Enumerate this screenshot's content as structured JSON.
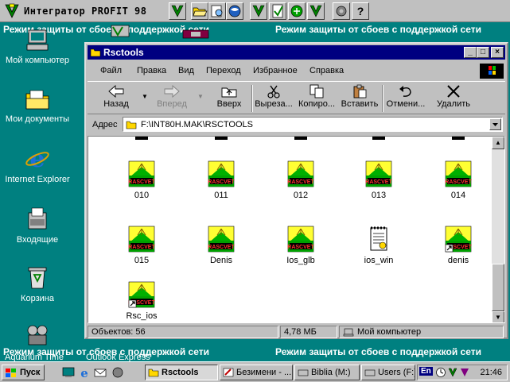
{
  "top_bar": {
    "title": "Интегратор PROFIT 98"
  },
  "banner": {
    "left": "Режим защиты от сбоев с поддержкой сети",
    "right": "Режим защиты от сбоев с поддержкой сети"
  },
  "desktop_icons": [
    {
      "label": "Мой компьютер",
      "icon": "my-computer-icon"
    },
    {
      "label": "Мои документы",
      "icon": "my-documents-icon"
    },
    {
      "label": "Internet Explorer",
      "icon": "internet-explorer-icon"
    },
    {
      "label": "Входящие",
      "icon": "inbox-icon"
    },
    {
      "label": "Корзина",
      "icon": "recycle-bin-icon"
    }
  ],
  "desktop_bottom_labels": {
    "aquarium": "Aquarium Time",
    "outlook": "Outlook Express"
  },
  "window": {
    "title": "Rsctools",
    "menu": [
      "Файл",
      "Правка",
      "Вид",
      "Переход",
      "Избранное",
      "Справка"
    ],
    "toolbar": {
      "back": "Назад",
      "forward": "Вперед",
      "up": "Вверх",
      "cut": "Выреза...",
      "copy": "Копиро...",
      "paste": "Вставить",
      "undo": "Отмени...",
      "delete": "Удалить"
    },
    "address": {
      "label": "Адрес",
      "value": "F:\\INT80H.MAK\\RSCTOOLS"
    },
    "files": [
      {
        "name": "010",
        "type": "rscvet"
      },
      {
        "name": "011",
        "type": "rscvet"
      },
      {
        "name": "012",
        "type": "rscvet"
      },
      {
        "name": "013",
        "type": "rscvet"
      },
      {
        "name": "014",
        "type": "rscvet"
      },
      {
        "name": "015",
        "type": "rscvet"
      },
      {
        "name": "Denis",
        "type": "rscvet"
      },
      {
        "name": "Ios_glb",
        "type": "rscvet"
      },
      {
        "name": "ios_win",
        "type": "notepad"
      },
      {
        "name": "denis",
        "type": "rscvet-shortcut"
      },
      {
        "name": "Rsc_ios",
        "type": "rscvet-shortcut"
      }
    ],
    "icon_caption": "RASCVET",
    "status": {
      "objects": "Объектов: 56",
      "size": "4,78 МБ",
      "location": "Мой компьютер"
    }
  },
  "taskbar": {
    "start": "Пуск",
    "tasks": [
      "Rsctools",
      "Безимени - ...",
      "Biblia (M:)",
      "Users (F:)"
    ],
    "tray_lang": "En",
    "clock": "21:46"
  },
  "colors": {
    "desktop": "#008080",
    "titlebar": "#000080",
    "face": "#c0c0c0"
  }
}
